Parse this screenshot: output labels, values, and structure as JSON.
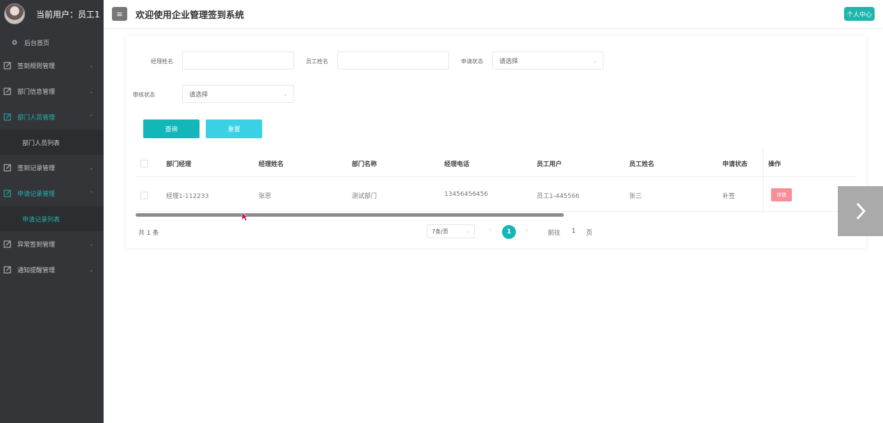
{
  "sidebar": {
    "user_label": "当前用户：员工1",
    "home_label": "后台首页",
    "items": [
      {
        "label": "签到规则管理"
      },
      {
        "label": "部门信息管理"
      },
      {
        "label": "部门人员管理",
        "sub": "部门人员列表"
      },
      {
        "label": "签到记录管理"
      },
      {
        "label": "申请记录管理",
        "sub": "申请记录列表"
      },
      {
        "label": "异常签到管理"
      },
      {
        "label": "通知提醒管理"
      }
    ]
  },
  "header": {
    "title": "欢迎使用企业管理签到系统",
    "profile_button": "个人中心",
    "menu_icon": "≡"
  },
  "filters": {
    "manager_name_label": "经理姓名",
    "employee_name_label": "员工姓名",
    "apply_status_label": "申请状态",
    "apply_status_value": "请选择",
    "review_status_label": "审核状态",
    "review_status_value": "请选择",
    "query_button": "查询",
    "reset_button": "重置"
  },
  "table": {
    "columns": [
      "部门经理",
      "经理姓名",
      "部门名称",
      "经理电话",
      "员工用户",
      "员工姓名",
      "申请状态",
      "操作"
    ],
    "rows": [
      {
        "dept_manager": "经理1-112233",
        "manager_name": "张思",
        "dept_name": "测试部门",
        "manager_phone": "13456456456",
        "employee_user": "员工1-445566",
        "employee_name": "张三",
        "apply_status": "补签",
        "action": "详情"
      }
    ]
  },
  "pagination": {
    "total": "共 1 条",
    "page_size": "7条/页",
    "current_page": "1",
    "goto_prefix": "前往",
    "goto_value": "1",
    "goto_suffix": "页"
  },
  "colors": {
    "accent": "#1fb5ad",
    "sidebar_bg": "#333539",
    "detail_button": "#f78f9b"
  }
}
